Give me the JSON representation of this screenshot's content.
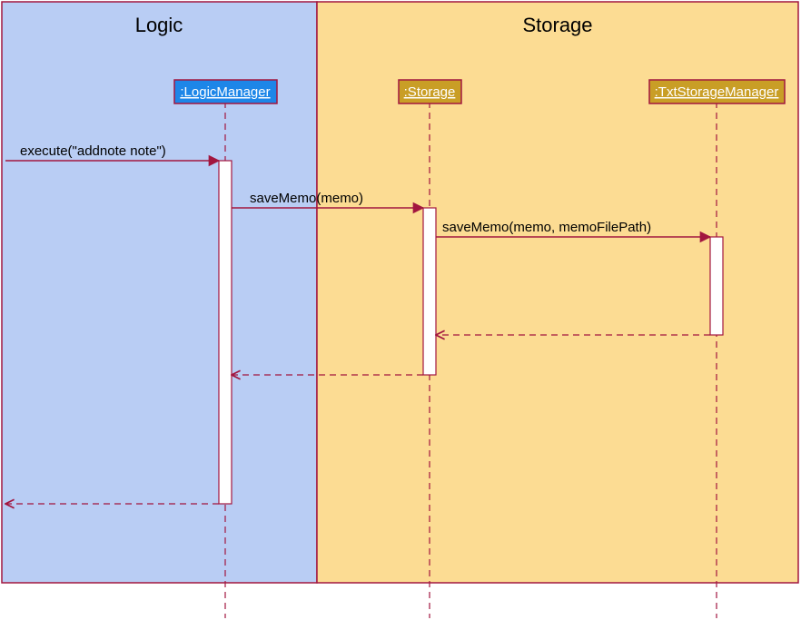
{
  "chart_data": {
    "type": "sequence-diagram",
    "participants": [
      {
        "partition": "Logic",
        "name": ":LogicManager"
      },
      {
        "partition": "Storage",
        "name": ":Storage"
      },
      {
        "partition": "Storage",
        "name": ":TxtStorageManager"
      }
    ],
    "messages": [
      {
        "from": "caller",
        "to": ":LogicManager",
        "label": "execute(\"addnote note\")",
        "type": "sync"
      },
      {
        "from": ":LogicManager",
        "to": ":Storage",
        "label": "saveMemo(memo)",
        "type": "sync"
      },
      {
        "from": ":Storage",
        "to": ":TxtStorageManager",
        "label": "saveMemo(memo, memoFilePath)",
        "type": "sync"
      },
      {
        "from": ":TxtStorageManager",
        "to": ":Storage",
        "label": "",
        "type": "return"
      },
      {
        "from": ":Storage",
        "to": ":LogicManager",
        "label": "",
        "type": "return"
      },
      {
        "from": ":LogicManager",
        "to": "caller",
        "label": "",
        "type": "return"
      }
    ]
  },
  "partitions": {
    "logic": {
      "title": "Logic"
    },
    "storage": {
      "title": "Storage"
    }
  },
  "objects": {
    "logicManager": {
      "label": ":LogicManager"
    },
    "storage": {
      "label": ":Storage"
    },
    "txtStorageManager": {
      "label": ":TxtStorageManager"
    }
  },
  "messages": {
    "m1": {
      "label": "execute(\"addnote note\")"
    },
    "m2": {
      "label": "saveMemo(memo)"
    },
    "m3": {
      "label": "saveMemo(memo, memoFilePath)"
    }
  }
}
